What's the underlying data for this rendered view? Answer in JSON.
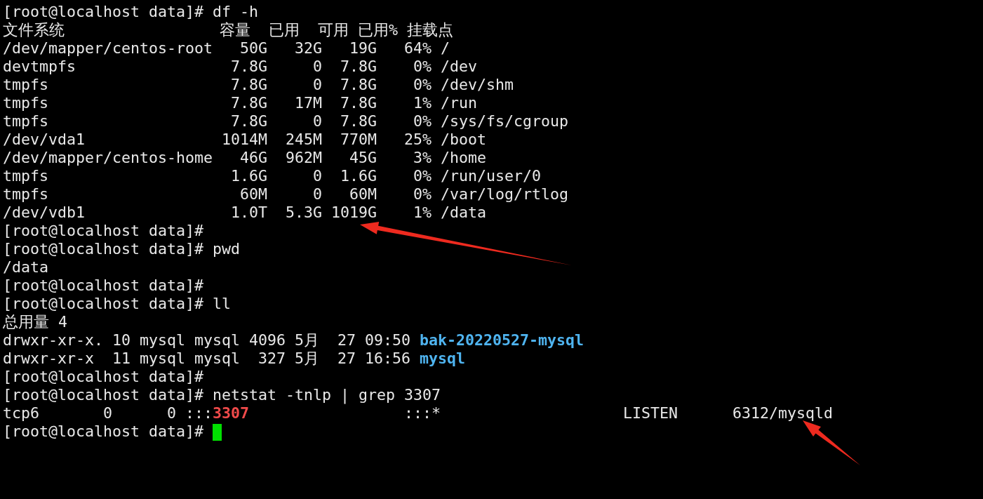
{
  "terminal": {
    "lines": [
      {
        "segments": [
          {
            "kind": "text",
            "text": "[root@localhost data]# df -h"
          }
        ]
      },
      {
        "segments": [
          {
            "kind": "text",
            "text": "文件系统                 容量  已用  可用 已用% 挂载点"
          }
        ]
      },
      {
        "segments": [
          {
            "kind": "text",
            "text": "/dev/mapper/centos-root   50G   32G   19G   64% /"
          }
        ]
      },
      {
        "segments": [
          {
            "kind": "text",
            "text": "devtmpfs                 7.8G     0  7.8G    0% /dev"
          }
        ]
      },
      {
        "segments": [
          {
            "kind": "text",
            "text": "tmpfs                    7.8G     0  7.8G    0% /dev/shm"
          }
        ]
      },
      {
        "segments": [
          {
            "kind": "text",
            "text": "tmpfs                    7.8G   17M  7.8G    1% /run"
          }
        ]
      },
      {
        "segments": [
          {
            "kind": "text",
            "text": "tmpfs                    7.8G     0  7.8G    0% /sys/fs/cgroup"
          }
        ]
      },
      {
        "segments": [
          {
            "kind": "text",
            "text": "/dev/vda1               1014M  245M  770M   25% /boot"
          }
        ]
      },
      {
        "segments": [
          {
            "kind": "text",
            "text": "/dev/mapper/centos-home   46G  962M   45G    3% /home"
          }
        ]
      },
      {
        "segments": [
          {
            "kind": "text",
            "text": "tmpfs                    1.6G     0  1.6G    0% /run/user/0"
          }
        ]
      },
      {
        "segments": [
          {
            "kind": "text",
            "text": "tmpfs                     60M     0   60M    0% /var/log/rtlog"
          }
        ]
      },
      {
        "segments": [
          {
            "kind": "text",
            "text": "/dev/vdb1                1.0T  5.3G 1019G    1% /data"
          }
        ]
      },
      {
        "segments": [
          {
            "kind": "text",
            "text": "[root@localhost data]#"
          }
        ]
      },
      {
        "segments": [
          {
            "kind": "text",
            "text": "[root@localhost data]# pwd"
          }
        ]
      },
      {
        "segments": [
          {
            "kind": "text",
            "text": "/data"
          }
        ]
      },
      {
        "segments": [
          {
            "kind": "text",
            "text": "[root@localhost data]#"
          }
        ]
      },
      {
        "segments": [
          {
            "kind": "text",
            "text": "[root@localhost data]# ll"
          }
        ]
      },
      {
        "segments": [
          {
            "kind": "text",
            "text": "总用量 4"
          }
        ]
      },
      {
        "segments": [
          {
            "kind": "text",
            "text": "drwxr-xr-x. 10 mysql mysql 4096 5月  27 09:50 "
          },
          {
            "kind": "dir",
            "text": "bak-20220527-mysql"
          }
        ]
      },
      {
        "segments": [
          {
            "kind": "text",
            "text": "drwxr-xr-x  11 mysql mysql  327 5月  27 16:56 "
          },
          {
            "kind": "dir",
            "text": "mysql"
          }
        ]
      },
      {
        "segments": [
          {
            "kind": "text",
            "text": "[root@localhost data]#"
          }
        ]
      },
      {
        "segments": [
          {
            "kind": "text",
            "text": "[root@localhost data]# netstat -tnlp | grep 3307"
          }
        ]
      },
      {
        "segments": [
          {
            "kind": "text",
            "text": "tcp6       0      0 :::"
          },
          {
            "kind": "match",
            "text": "3307"
          },
          {
            "kind": "text",
            "text": "                 :::*                    LISTEN      6312/mysqld"
          }
        ]
      },
      {
        "segments": [
          {
            "kind": "text",
            "text": "[root@localhost data]# "
          },
          {
            "kind": "cursor"
          }
        ]
      }
    ]
  },
  "annotations": [
    {
      "kind": "arrow"
    },
    {
      "kind": "arrow"
    }
  ]
}
